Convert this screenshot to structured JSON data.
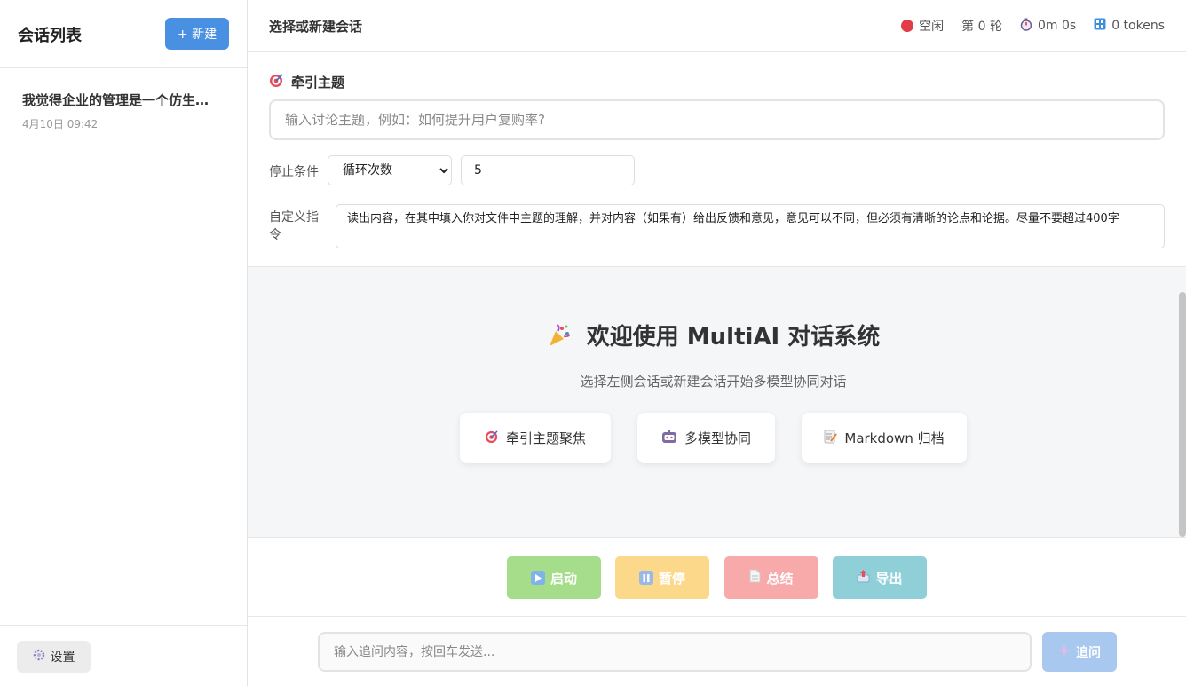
{
  "sidebar": {
    "title": "会话列表",
    "new_button": "+ 新建",
    "sessions": [
      {
        "title": "我觉得企业的管理是一个仿生…",
        "time": "4月10日 09:42"
      }
    ],
    "settings_button": "设置"
  },
  "topbar": {
    "title": "选择或新建会话",
    "status": "空闲",
    "round": "第 0 轮",
    "duration": "0m 0s",
    "tokens": "0 tokens"
  },
  "config": {
    "topic_label": "牵引主题",
    "topic_placeholder": "输入讨论主题，例如：如何提升用户复购率?",
    "stop_label": "停止条件",
    "stop_condition": "循环次数",
    "stop_value": "5",
    "custom_label": "自定义指令",
    "custom_instruction": "读出内容，在其中填入你对文件中主题的理解，并对内容（如果有）给出反馈和意见，意见可以不同，但必须有清晰的论点和论据。尽量不要超过400字"
  },
  "welcome": {
    "title": "欢迎使用 MultiAI 对话系统",
    "subtitle": "选择左侧会话或新建会话开始多模型协同对话",
    "features": [
      {
        "label": "牵引主题聚焦",
        "icon": "target-icon"
      },
      {
        "label": "多模型协同",
        "icon": "robot-icon"
      },
      {
        "label": "Markdown 归档",
        "icon": "memo-icon"
      }
    ]
  },
  "controls": {
    "start": "启动",
    "pause": "暂停",
    "summary": "总结",
    "export": "导出"
  },
  "ask": {
    "placeholder": "输入追问内容，按回车发送...",
    "button": "追问"
  },
  "colors": {
    "accent": "#4a90e2",
    "start": "#a6dd8b",
    "pause": "#fcd98a",
    "summary": "#f8a9a9",
    "export": "#8fd0d8",
    "status_idle": "#e23b4a"
  }
}
